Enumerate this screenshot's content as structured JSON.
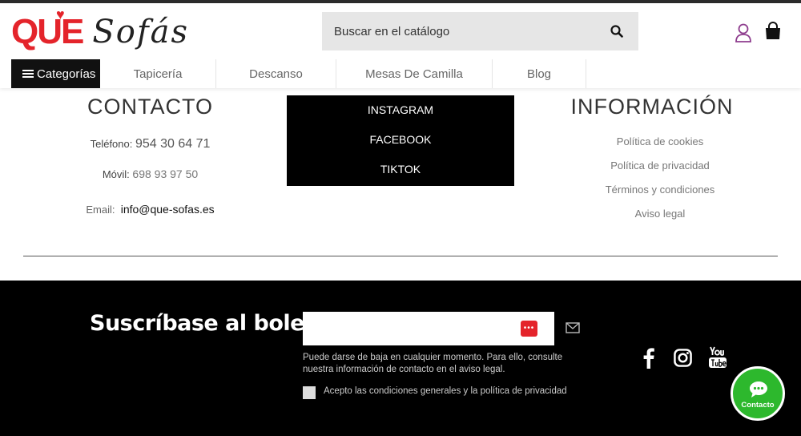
{
  "header": {
    "logo_que": "QUE",
    "logo_sofas": "Sofás",
    "search_placeholder": "Buscar en el catálogo"
  },
  "nav": {
    "categories_label": "Categorías",
    "items": [
      "Tapicería",
      "Descanso",
      "Mesas De Camilla",
      "Blog"
    ]
  },
  "contact": {
    "title": "CONTACTO",
    "phone_label": "Teléfono:",
    "phone_value": "954 30 64 71",
    "mobile_label": "Móvil:",
    "mobile_value": "698 93 97 50",
    "email_label": "Email:",
    "email_value": "info@que-sofas.es"
  },
  "social_menu": [
    "INSTAGRAM",
    "FACEBOOK",
    "TIKTOK"
  ],
  "info": {
    "title": "INFORMACIÓN",
    "links": [
      "Política de cookies",
      "Política de privacidad",
      "Términos y condiciones",
      "Aviso legal"
    ]
  },
  "newsletter": {
    "title": "Suscríbase al boletín",
    "note": "Puede darse de baja en cualquier momento. Para ello, consulte nuestra información de contacto en el aviso legal.",
    "checkbox_label": "Acepto las condiciones generales y la política de privacidad"
  },
  "fab": {
    "label": "Contacto"
  },
  "colors": {
    "brand_red": "#e4242b",
    "fab_green": "#2db82d"
  }
}
